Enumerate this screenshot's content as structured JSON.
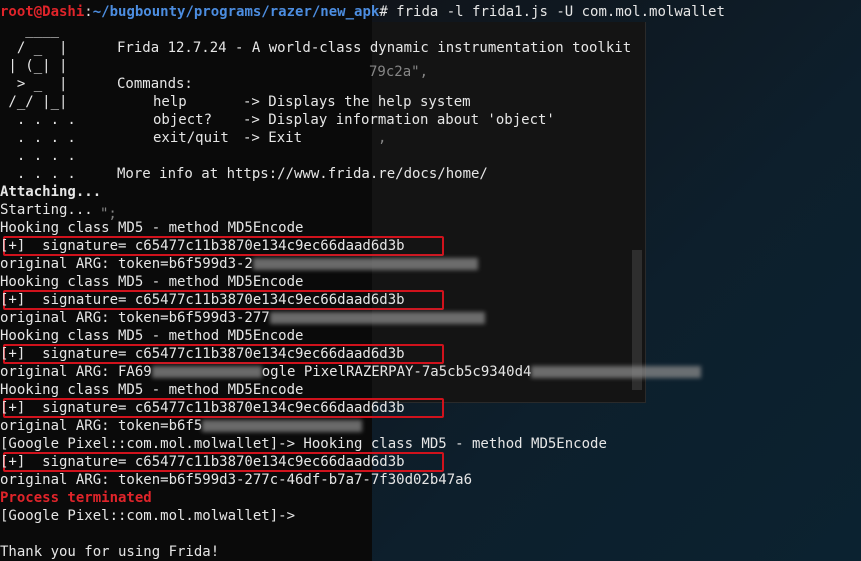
{
  "background": {
    "fragments": [
      "79c2a\",",
      ",",
      "\";"
    ],
    "colors": {
      "terminal_bg": "#0a0a0a",
      "prompt_user": "#e0242a",
      "prompt_path": "#4c8de0",
      "highlight_box": "#d0121c"
    }
  },
  "prompt": {
    "user": "root@Dashi",
    "separator": ":",
    "path": "~/bugbounty/programs/razer/new_apk",
    "symbol": "# ",
    "command": "frida -l frida1.js -U com.mol.molwallet"
  },
  "banner": {
    "logo": [
      "   ____",
      "  / _  |",
      " | (_| |",
      "  > _  |",
      " /_/ |_|",
      "  . . . .",
      "  . . . .",
      "  . . . .",
      "  . . . ."
    ],
    "title": "Frida 12.7.24 - A world-class dynamic instrumentation toolkit",
    "commands_label": "Commands:",
    "commands": [
      {
        "name": "help",
        "desc": "-> Displays the help system"
      },
      {
        "name": "object?",
        "desc": "-> Display information about 'object'"
      },
      {
        "name": "exit/quit",
        "desc": "-> Exit"
      }
    ],
    "more_info": "More info at https://www.frida.re/docs/home/"
  },
  "output": {
    "attaching": "Attaching...",
    "starting": "Starting...",
    "hooking": "Hooking class MD5 - method MD5Encode",
    "signature": "[+]  signature= c65477c11b3870e134c9ec66daad6d3b",
    "arg1": "original ARG: token=b6f599d3-2",
    "arg2": "original ARG: token=b6f599d3-277",
    "arg3_prefix": "original ARG: FA69",
    "arg3_mid": "ogle PixelRAZERPAY-7a5cb5c9340d4",
    "arg4": "original ARG: token=b6f5",
    "device_hook": "[Google Pixel::com.mol.molwallet]-> Hooking class MD5 - method MD5Encode",
    "arg5": "original ARG: token=b6f599d3-277c-46df-b7a7-7f30d02b47a6",
    "terminated": "Process terminated",
    "device_prompt": "[Google Pixel::com.mol.molwallet]->",
    "thanks": "Thank you for using Frida!"
  }
}
